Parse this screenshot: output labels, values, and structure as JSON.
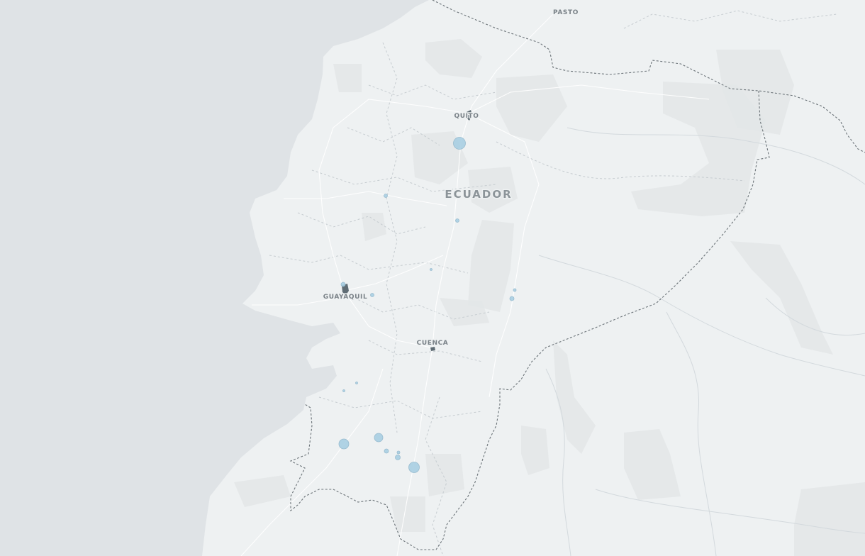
{
  "map": {
    "country_label": "ECUADOR",
    "cities": [
      {
        "name": "PASTO"
      },
      {
        "name": "QUITO"
      },
      {
        "name": "GUAYAQUIL"
      },
      {
        "name": "CUENCA"
      }
    ],
    "colors": {
      "ocean": "#dfe3e6",
      "land": "#eef1f2",
      "terrain": "#e3e6e7",
      "border": "#6b7378",
      "bubble": "#a9cfe3",
      "label": "#7a8288"
    }
  }
}
